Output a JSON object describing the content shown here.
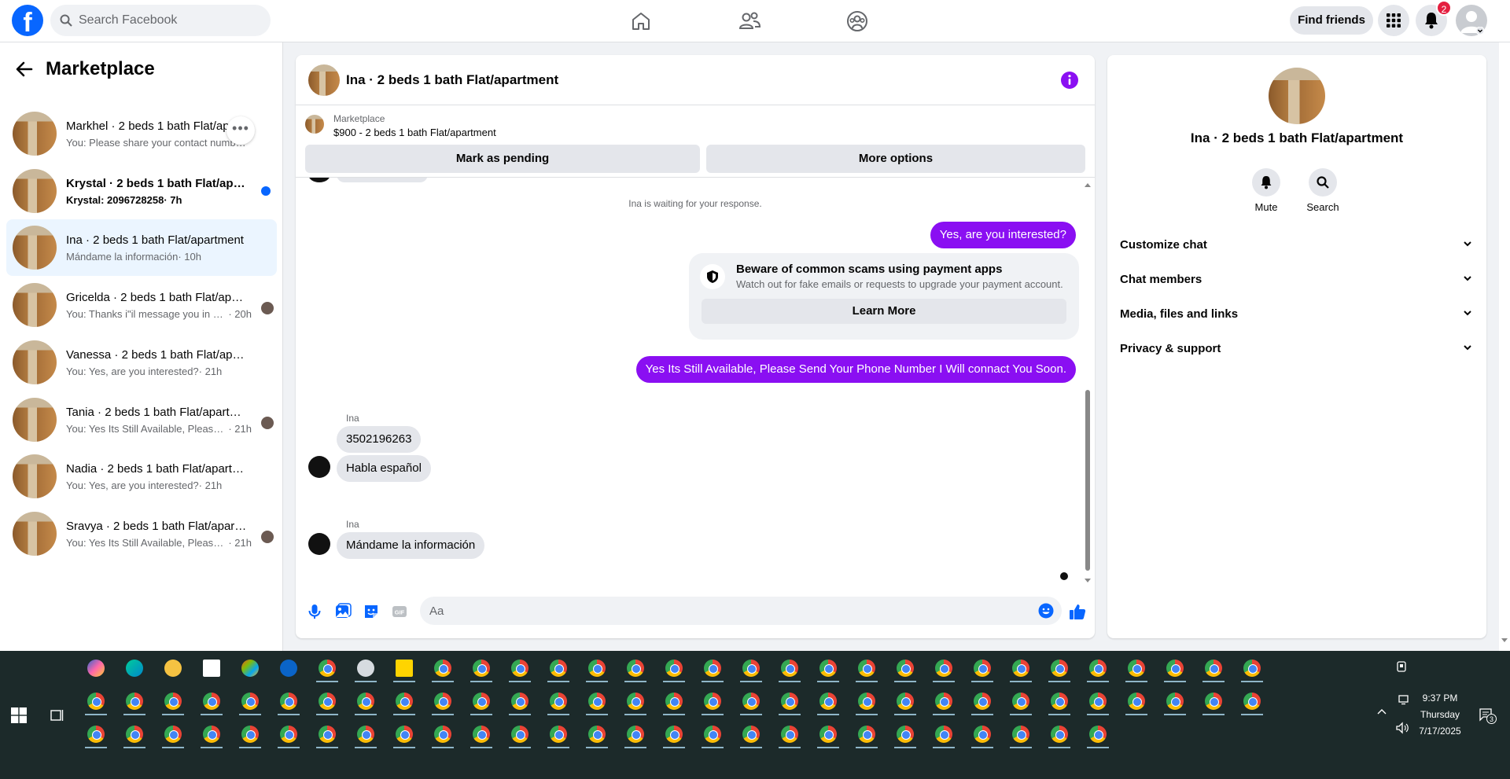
{
  "topbar": {
    "logo_letter": "f",
    "search_placeholder": "Search Facebook",
    "find_friends_label": "Find friends",
    "notification_count": "2"
  },
  "sidebar": {
    "title": "Marketplace",
    "conversations": [
      {
        "title": "Markhel · 2 beds 1 bath Flat/ap…",
        "snippet": "You: Please share your contact numb… m",
        "time": "",
        "bold": false,
        "indicator": "more"
      },
      {
        "title": "Krystal · 2 beds 1 bath Flat/apart…",
        "snippet": "Krystal: 2096728258",
        "time": " · 7h",
        "bold": true,
        "indicator": "unread"
      },
      {
        "title": "Ina · 2 beds 1 bath Flat/apartment",
        "snippet": "Mándame la información",
        "time": " · 10h",
        "bold": false,
        "indicator": "none"
      },
      {
        "title": "Gricelda · 2 beds 1 bath Flat/apa…",
        "snippet": "You: Thanks i\"il message you in a …",
        "time": " · 20h",
        "bold": false,
        "indicator": "avatar"
      },
      {
        "title": "Vanessa · 2 beds 1 bath Flat/apart…",
        "snippet": "You: Yes, are you interested?",
        "time": " · 21h",
        "bold": false,
        "indicator": "none"
      },
      {
        "title": "Tania · 2 beds 1 bath Flat/apart…",
        "snippet": "You: Yes Its Still Available, Please S…",
        "time": " · 21h",
        "bold": false,
        "indicator": "avatar"
      },
      {
        "title": "Nadia · 2 beds 1 bath Flat/apartme…",
        "snippet": "You: Yes, are you interested?",
        "time": " · 21h",
        "bold": false,
        "indicator": "none"
      },
      {
        "title": "Sravya · 2 beds 1 bath Flat/apart…",
        "snippet": "You: Yes Its Still Available, Please S…",
        "time": " · 21h",
        "bold": false,
        "indicator": "avatar"
      }
    ]
  },
  "chat": {
    "title": "Ina · 2 beds 1 bath Flat/apartment",
    "listing_label": "Marketplace",
    "listing_price": "$900 - 2 beds 1 bath Flat/apartment",
    "mark_pending_label": "Mark as pending",
    "more_options_label": "More options",
    "system_note": "Ina is waiting for your response.",
    "out_msg_1": "Yes, are you interested?",
    "scam_title": "Beware of common scams using payment apps",
    "scam_desc": "Watch out for fake emails or requests to upgrade your payment account.",
    "learn_more_label": "Learn More",
    "out_msg_2": "Yes Its Still Available, Please Send Your Phone Number I Will connact You Soon.",
    "sender_1": "Ina",
    "in_msg_1": "3502196263",
    "in_msg_2": "Habla español",
    "sender_2": "Ina",
    "in_msg_3": "Mándame la información",
    "composer_placeholder": "Aa"
  },
  "info_panel": {
    "title": "Ina · 2 beds 1 bath Flat/apartment",
    "mute_label": "Mute",
    "search_label": "Search",
    "sections": [
      "Customize chat",
      "Chat members",
      "Media, files and links",
      "Privacy & support"
    ]
  },
  "taskbar": {
    "time": "9:37 PM",
    "day": "Thursday",
    "date": "7/17/2025",
    "notification_count": "3"
  },
  "colors": {
    "brand_blue": "#0866ff",
    "outgoing_bubble": "#8a0ff2",
    "taskbar_bg": "#1c2a2a"
  }
}
